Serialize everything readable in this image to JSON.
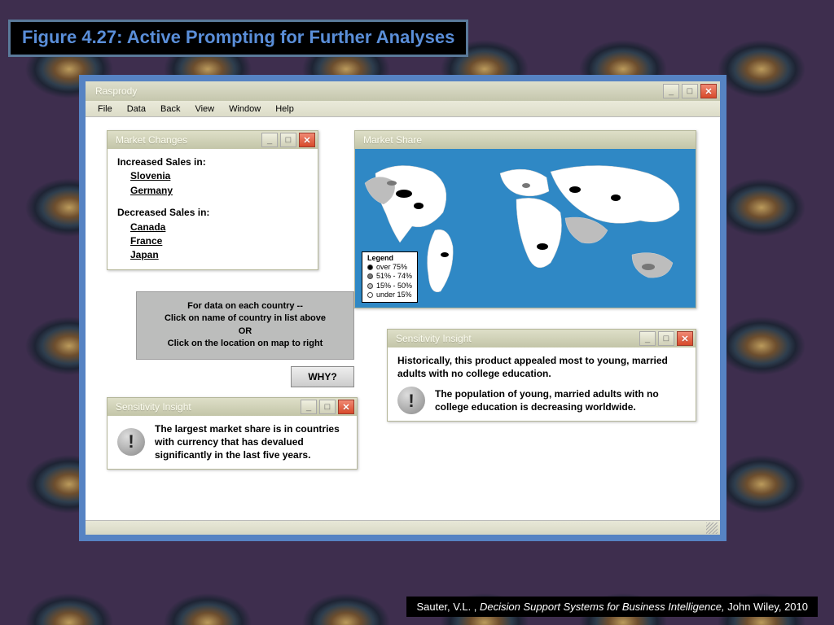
{
  "caption": "Figure 4.27:  Active Prompting for Further Analyses",
  "app_title": "Rasprody",
  "menu": [
    "File",
    "Data",
    "Back",
    "View",
    "Window",
    "Help"
  ],
  "market_changes": {
    "title": "Market Changes",
    "increased_header": "Increased Sales in:",
    "increased": [
      "Slovenia",
      "Germany"
    ],
    "decreased_header": "Decreased Sales in:",
    "decreased": [
      "Canada",
      "France",
      "Japan"
    ]
  },
  "instructions": {
    "line1": "For data on each country --",
    "line2": "Click on name of country in list above",
    "line3": "OR",
    "line4": "Click on the location on map to right"
  },
  "why_label": "WHY?",
  "sensitivity1": {
    "title": "Sensitivity Insight",
    "text": "The largest market share is in countries with currency that has devalued significantly in the last five years."
  },
  "map": {
    "title": "Market Share",
    "legend_title": "Legend",
    "legend": [
      "over 75%",
      "51% - 74%",
      "15% - 50%",
      "under 15%"
    ]
  },
  "sensitivity2": {
    "title": "Sensitivity Insight",
    "top": "Historically, this product appealed most to young, married adults with no college education.",
    "detail": "The population of  young, married adults with no college education is decreasing worldwide."
  },
  "citation": {
    "author": "Sauter, V.L. , ",
    "title": "Decision Support Systems for Business Intelligence, ",
    "pub": "John Wiley, 2010"
  }
}
